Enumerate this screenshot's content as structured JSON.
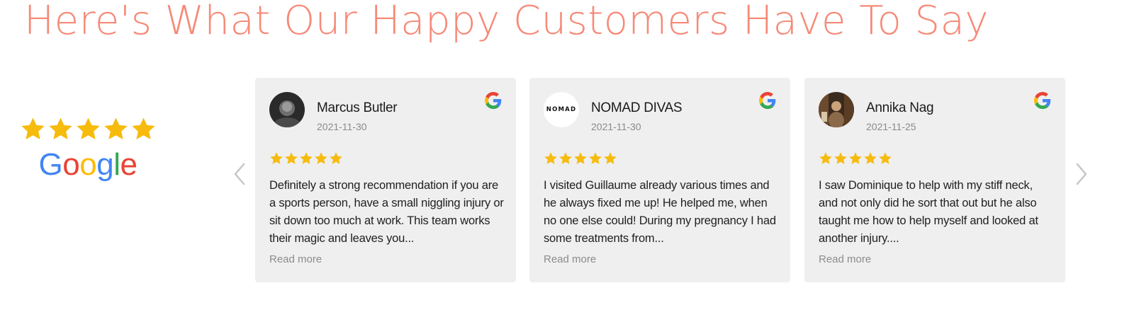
{
  "heading": "Here's What Our Happy Customers Have To Say",
  "summary": {
    "rating_stars": 5,
    "platform_letters": [
      {
        "char": "G",
        "color": "#4285F4"
      },
      {
        "char": "o",
        "color": "#EA4335"
      },
      {
        "char": "o",
        "color": "#FBBC05"
      },
      {
        "char": "g",
        "color": "#4285F4"
      },
      {
        "char": "l",
        "color": "#34A853"
      },
      {
        "char": "e",
        "color": "#EA4335"
      }
    ]
  },
  "colors": {
    "heading": "#f68a78",
    "star": "#f7bb0e",
    "card_bg": "#efefef",
    "arrow": "#c8c8c8"
  },
  "icons": {
    "prev": "chevron-left-icon",
    "next": "chevron-right-icon",
    "source": "google-g-icon",
    "star": "star-icon"
  },
  "reviews": [
    {
      "name": "Marcus Butler",
      "date": "2021-11-30",
      "stars": 5,
      "text": "Definitely a strong recommendation if you are a sports person, have a small niggling injury or sit down too much at work. This team works their magic and leaves you...",
      "read_more": "Read more"
    },
    {
      "name": "NOMAD DIVAS",
      "avatar_text": "NOMAD",
      "date": "2021-11-30",
      "stars": 5,
      "text": "I visited Guillaume already various times and he always fixed me up! He helped me, when no one else could! During my pregnancy I had some treatments from...",
      "read_more": "Read more"
    },
    {
      "name": "Annika Nag",
      "date": "2021-11-25",
      "stars": 5,
      "text": "I saw Dominique to help with my stiff neck, and not only did he sort that out but he also taught me how to help myself and looked at another injury....",
      "read_more": "Read more"
    }
  ]
}
